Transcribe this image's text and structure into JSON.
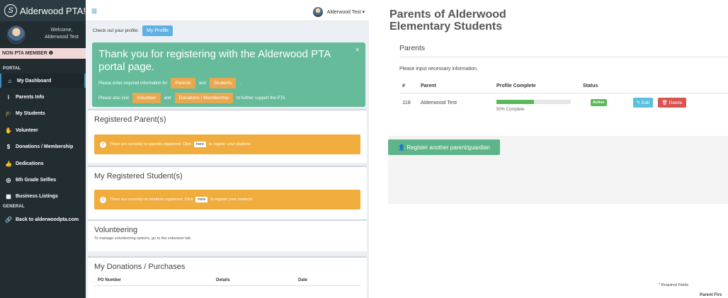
{
  "left_screen": {
    "brand": "Alderwood PTA!",
    "welcome": "Welcome,",
    "user_name": "Alderwood Test",
    "membership_status": "NON PTA MEMBER",
    "nav": {
      "portal_header": "PORTAL",
      "general_header": "GENERAL",
      "items": [
        {
          "label": "My Dashboard",
          "icon": "home-icon"
        },
        {
          "label": "Parents Info",
          "icon": "info-icon"
        },
        {
          "label": "My Students",
          "icon": "graduation-cap-icon"
        },
        {
          "label": "Volunteer",
          "icon": "hand-icon"
        },
        {
          "label": "Donations / Membership",
          "icon": "dollar-icon"
        },
        {
          "label": "Dedications",
          "icon": "thumbs-up-icon"
        },
        {
          "label": "6th Grade Selfies",
          "icon": "camera-icon"
        },
        {
          "label": "Business Listings",
          "icon": "building-icon"
        }
      ],
      "back_link": "Back to alderwoodpta.com"
    },
    "topbar_user": "Alderwood Test",
    "profile_prompt": "Check out your profile:",
    "profile_button": "My Profile",
    "callout": {
      "title": "Thank you for registering with the Alderwood PTA portal page.",
      "line1_prefix": "Please enter required information for",
      "parents_chip": "Parents",
      "and1": "and",
      "students_chip": "Students",
      "line1_suffix": ".",
      "line2_prefix": "Please also visit",
      "volunteer_chip": "Volunteer",
      "and2": "and",
      "donations_chip": "Donations / Membership",
      "line2_suffix": "to further support the PTA."
    },
    "registered_parents": {
      "title": "Registered Parent(s)",
      "alert_prefix": "There are currently no parents registered. Click",
      "here": "here",
      "alert_suffix": "to register your students"
    },
    "registered_students": {
      "title": "My Registered Student(s)",
      "alert_prefix": "There are currently no students registered. Click",
      "here": "here",
      "alert_suffix": "to register your students"
    },
    "volunteering": {
      "title": "Volunteering",
      "subtitle": "To manage volunteering options, go to the volunteer tab."
    },
    "donations": {
      "title": "My Donations / Purchases",
      "columns": [
        "PO Number",
        "Details",
        "Date"
      ]
    }
  },
  "right_screen": {
    "page_title_line1": "Parents of Alderwood",
    "page_title_line2": "Elementary Students",
    "box_title": "Parents",
    "info_text": "Please input necessary information.",
    "columns": [
      "#",
      "Parent",
      "Profile Complete",
      "Status"
    ],
    "rows": [
      {
        "id": "118",
        "parent": "Alderwood Test",
        "progress": 0.5,
        "progress_label": "50% Complete",
        "status": "Active"
      }
    ],
    "edit_label": "Edit",
    "delete_label": "Delete",
    "register_button": "Register another parent/guardian",
    "required_note": "* Required Fields",
    "cut_off_text": "Parent Firs"
  },
  "colors": {
    "sidebar_bg": "#222d32",
    "accent_blue": "#3c8dbc",
    "callout_green": "#66bb9a",
    "warning_orange": "#f0ad3e",
    "success_green": "#5cb85c",
    "danger_red": "#d9534f"
  }
}
